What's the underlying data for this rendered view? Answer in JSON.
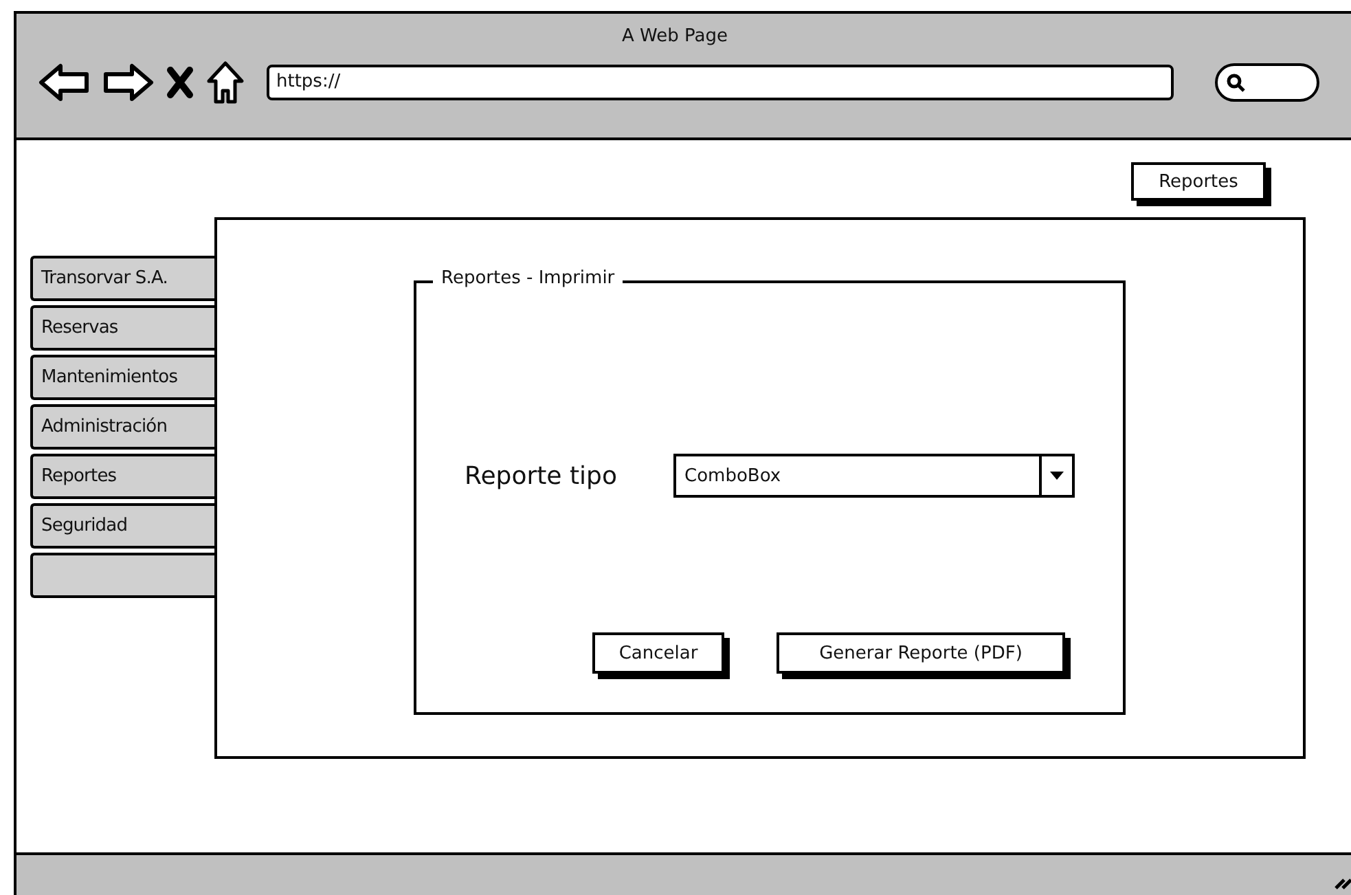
{
  "window": {
    "title": "A Web Page"
  },
  "address_bar": {
    "value": "https://"
  },
  "header_button": "Reportes",
  "sidebar": {
    "items": [
      {
        "label": "Transorvar S.A."
      },
      {
        "label": "Reservas"
      },
      {
        "label": "Mantenimientos"
      },
      {
        "label": "Administración"
      },
      {
        "label": "Reportes"
      },
      {
        "label": "Seguridad"
      }
    ]
  },
  "dialog": {
    "legend": "Reportes - Imprimir",
    "field_label": "Reporte tipo",
    "combobox": {
      "value": "ComboBox"
    },
    "buttons": [
      "Cancelar",
      "Generar Reporte (PDF)"
    ]
  }
}
